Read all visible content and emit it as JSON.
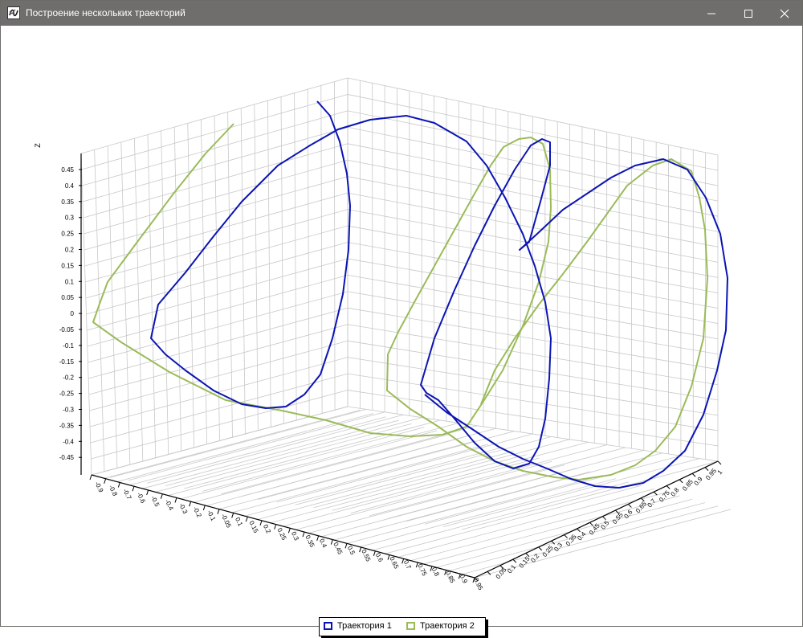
{
  "window": {
    "title": "Построение нескольких траекторий",
    "icon": "app-chart-icon",
    "controls": [
      "minimize-icon",
      "maximize-icon",
      "close-icon"
    ]
  },
  "colors": {
    "titlebar": "#706e6c",
    "grid": "#c8c8c8",
    "axis": "#000000",
    "series1": "#0b14b4",
    "series2": "#9bbb59"
  },
  "chart_data": {
    "type": "line3d",
    "title": "",
    "zlabel": "Z",
    "grid": true,
    "legend_position": "bottom-center",
    "x_ticks": [
      "-0.9",
      "-0.8",
      "-0.7",
      "-0.6",
      "-0.5",
      "-0.4",
      "-0.3",
      "-0.2",
      "-0.1",
      "-0.05",
      "0.1",
      "0.15",
      "0.2",
      "0.25",
      "0.3",
      "0.35",
      "0.4",
      "0.45",
      "0.5",
      "0.55",
      "0.6",
      "0.65",
      "0.7",
      "0.75",
      "0.8",
      "0.85",
      "0.9",
      "0.95"
    ],
    "y_ticks": [
      "0.05",
      "0.1",
      "0.15",
      "0.2",
      "0.25",
      "0.3",
      "0.35",
      "0.4",
      "0.45",
      "0.5",
      "0.55",
      "0.6",
      "0.65",
      "0.7",
      "0.75",
      "0.8",
      "0.85",
      "0.9",
      "0.95",
      "1"
    ],
    "z_ticks": [
      "0.45",
      "0.4",
      "0.35",
      "0.3",
      "0.25",
      "0.2",
      "0.15",
      "0.1",
      "0.05",
      "0",
      "-0.05",
      "-0.1",
      "-0.15",
      "-0.2",
      "-0.25",
      "-0.3",
      "-0.35",
      "-0.4",
      "-0.45"
    ],
    "series": [
      {
        "name": "Траектория 1",
        "color": "#0b14b4"
      },
      {
        "name": "Траектория 2",
        "color": "#9bbb59"
      }
    ]
  },
  "legend": {
    "item1": "Траектория 1",
    "item2": "Траектория 2"
  }
}
